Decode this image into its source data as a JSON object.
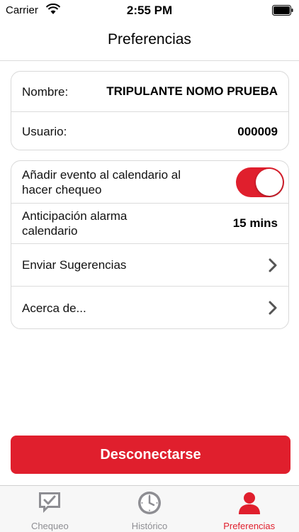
{
  "status_bar": {
    "carrier": "Carrier",
    "time": "2:55 PM"
  },
  "nav": {
    "title": "Preferencias"
  },
  "profile": {
    "name_label": "Nombre:",
    "name_value": "TRIPULANTE NOMO PRUEBA",
    "user_label": "Usuario:",
    "user_value": "000009"
  },
  "settings": {
    "calendar_event_label": "Añadir evento al calendario al hacer chequeo",
    "calendar_event_enabled": true,
    "alarm_label": "Anticipación alarma calendario",
    "alarm_value": "15 mins",
    "suggestions_label": "Enviar Sugerencias",
    "about_label": "Acerca de..."
  },
  "logout_label": "Desconectarse",
  "tabs": [
    {
      "label": "Chequeo",
      "icon": "chat-check-icon",
      "active": false
    },
    {
      "label": "Histórico",
      "icon": "clock-icon",
      "active": false
    },
    {
      "label": "Preferencias",
      "icon": "person-icon",
      "active": true
    }
  ],
  "colors": {
    "accent": "#e01f2d",
    "inactive": "#8e8e93"
  }
}
